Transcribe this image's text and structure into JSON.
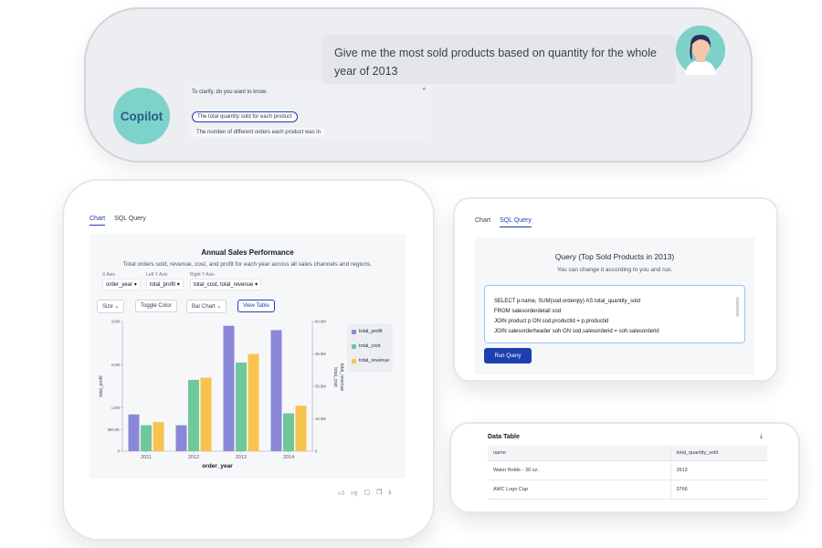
{
  "chat": {
    "user_message": "Give me the most sold products based on quantity for the whole year of 2013",
    "assistant_name": "Copilot",
    "clarify_question": "To clarify, do you want to know:",
    "options": [
      "The total quantity sold for each product",
      "The number of different orders each product was in"
    ]
  },
  "chart_panel": {
    "tabs": [
      "Chart",
      "SQL Query"
    ],
    "active_tab": "Chart",
    "title": "Annual Sales Performance",
    "subtitle": "Total orders sold, revenue, cost, and profit for each year across all sales channels and regions.",
    "x_axis_label": "X Axis",
    "x_axis_value": "order_year",
    "left_y_label": "Left Y Axis",
    "left_y_value": "total_profit",
    "right_y_label": "Right Y Axis",
    "right_y_value": "total_cost, total_revenue",
    "buttons": {
      "size": "Size",
      "toggle_color": "Toggle Color",
      "bar_chart": "Bar Chart",
      "view_table": "View Table"
    },
    "colors": {
      "total_profit": "#8b87d9",
      "total_cost": "#6fc79a",
      "total_revenue": "#f7c34f"
    }
  },
  "chart_data": {
    "type": "bar",
    "categories": [
      "2011",
      "2012",
      "2013",
      "2014"
    ],
    "series": [
      {
        "name": "total_profit",
        "axis": "left",
        "values": [
          0.85,
          0.6,
          2.9,
          2.8
        ]
      },
      {
        "name": "total_cost",
        "axis": "right",
        "values": [
          12.0,
          33.0,
          41.0,
          17.5
        ]
      },
      {
        "name": "total_revenue",
        "axis": "right",
        "values": [
          13.5,
          34.0,
          45.0,
          21.0
        ]
      }
    ],
    "xlabel": "order_year",
    "ylabel_left": "total_profit",
    "ylabel_right": "total_cost, total_revenue",
    "left_ticks": [
      "0",
      "500.0K",
      "1.0M",
      "2.0M",
      "3.0M"
    ],
    "right_ticks": [
      "0",
      "15.0M",
      "30.0M",
      "45.0M",
      "60.0M"
    ],
    "ylim_left": [
      0,
      3.0
    ],
    "ylim_right": [
      0,
      60
    ],
    "legend_position": "right"
  },
  "sql_panel": {
    "tabs": [
      "Chart",
      "SQL Query"
    ],
    "active_tab": "SQL Query",
    "title": "Query (Top Sold Products in 2013)",
    "subtitle": "You can change it according to you and run.",
    "code_lines": [
      "SELECT p.name, SUM(sod.orderqty) AS total_quantity_sold",
      "FROM salesorderdetail sod",
      "JOIN product p ON sod.productid = p.productid",
      "JOIN salesorderheader soh ON sod.salesorderid = soh.salesorderid"
    ],
    "run_label": "Run Query"
  },
  "table_panel": {
    "title": "Data Table",
    "columns": [
      "name",
      "total_quantity_sold"
    ],
    "rows": [
      [
        "Water Bottle - 30 oz.",
        "3913"
      ],
      [
        "AWC Logo Cap",
        "3766"
      ]
    ]
  }
}
